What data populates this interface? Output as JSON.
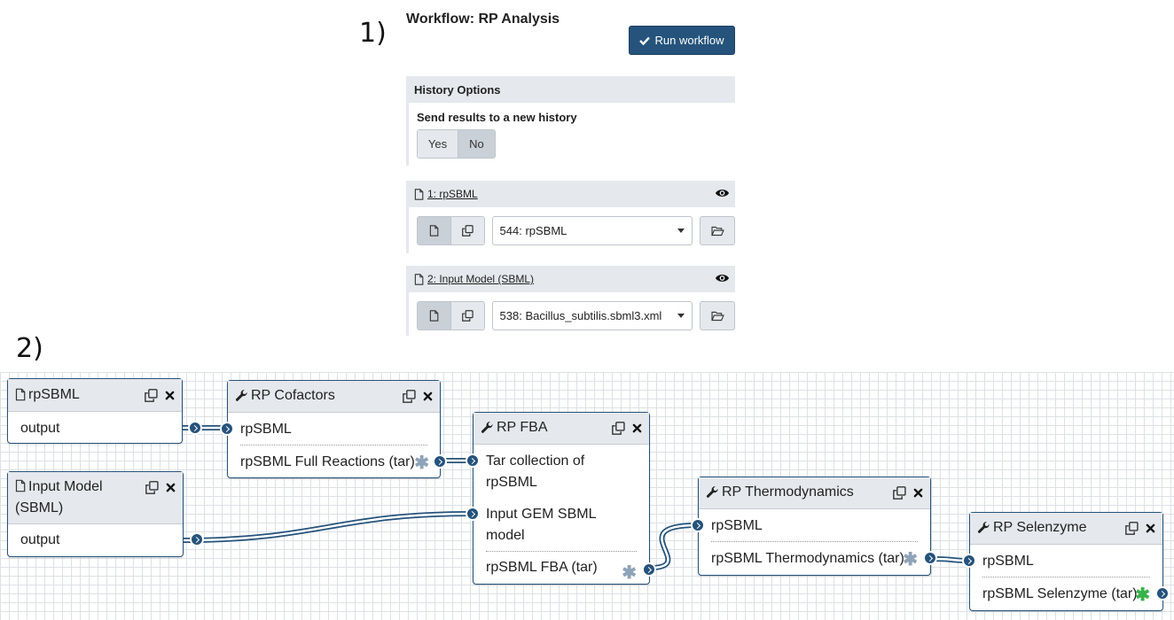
{
  "labels": {
    "step1": "1)",
    "step2": "2)"
  },
  "form": {
    "title": "Workflow: RP Analysis",
    "run_button": "Run workflow",
    "history": {
      "header": "History Options",
      "label": "Send results to a new history",
      "yes": "Yes",
      "no": "No",
      "selected": "No"
    },
    "inputs": [
      {
        "title": "1: rpSBML",
        "selected": "544: rpSBML"
      },
      {
        "title": "2: Input Model (SBML)",
        "selected": "538: Bacillus_subtilis.sbml3.xml"
      }
    ]
  },
  "editor": {
    "nodes": {
      "rpsbml": {
        "title": "rpSBML",
        "output": "output"
      },
      "input_model": {
        "title": "Input Model (SBML)",
        "output": "output"
      },
      "cofactors": {
        "title": "RP Cofactors",
        "input": "rpSBML",
        "output": "rpSBML Full Reactions (tar)"
      },
      "fba": {
        "title": "RP FBA",
        "input1": "Tar collection of rpSBML",
        "input2": "Input GEM SBML model",
        "output": "rpSBML FBA (tar)"
      },
      "thermo": {
        "title": "RP Thermodynamics",
        "input": "rpSBML",
        "output": "rpSBML Thermodynamics (tar)"
      },
      "selenzyme": {
        "title": "RP Selenzyme",
        "input": "rpSBML",
        "output": "rpSBML Selenzyme (tar)"
      }
    }
  },
  "colors": {
    "primary": "#25537b",
    "panel": "#e5e8ec",
    "collection_star": "#8fa3b8",
    "active_star": "#38b34a"
  },
  "icons": [
    "check-icon",
    "eye-icon",
    "file-icon",
    "copy-icon",
    "folder-open-icon",
    "close-icon",
    "wrench-icon",
    "asterisk-icon",
    "chevron-right-icon"
  ]
}
